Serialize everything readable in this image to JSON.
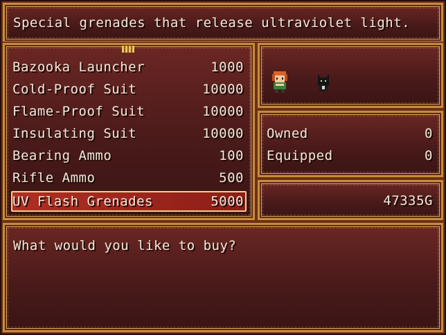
{
  "help_text": "Special grenades that release ultraviolet light.",
  "items": [
    {
      "name": "Bazooka Launcher",
      "price": "1000"
    },
    {
      "name": "Cold-Proof Suit",
      "price": "10000"
    },
    {
      "name": "Flame-Proof Suit",
      "price": "10000"
    },
    {
      "name": "Insulating Suit",
      "price": "10000"
    },
    {
      "name": "Bearing Ammo",
      "price": "100"
    },
    {
      "name": "Rifle Ammo",
      "price": "500"
    },
    {
      "name": "UV Flash Grenades",
      "price": "5000"
    }
  ],
  "selected_index": 6,
  "status": {
    "owned_label": "Owned",
    "owned_value": "0",
    "equipped_label": "Equipped",
    "equipped_value": "0"
  },
  "gold": "47335G",
  "message": "What would you like to buy?",
  "colors": {
    "window_border": "#c98a40",
    "window_fill": "#5a1f1c",
    "selection": "#b02f22",
    "text": "#f2e8d8"
  },
  "icons": [
    "scroll-up-indicator-icon",
    "party-member-redhead-sprite-icon",
    "party-member-black-cat-sprite-icon"
  ]
}
